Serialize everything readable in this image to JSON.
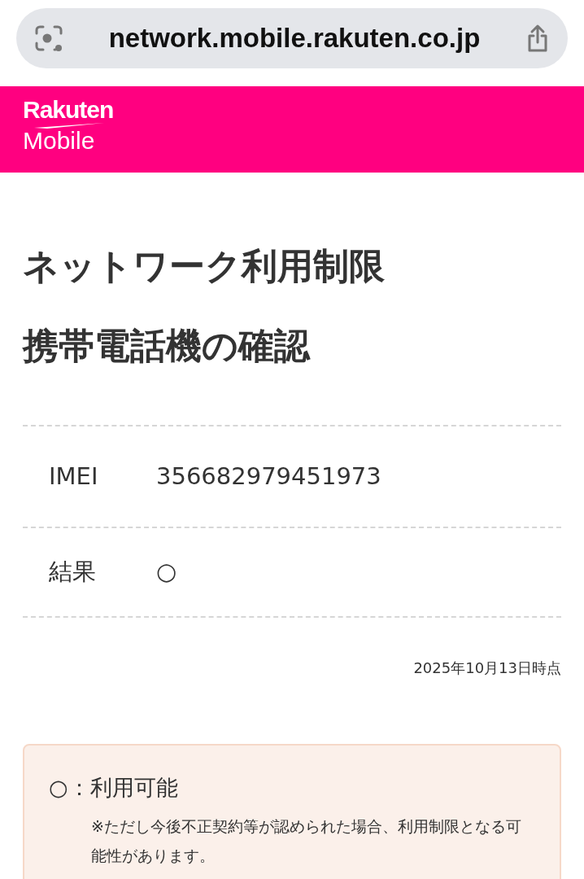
{
  "browser": {
    "url": "network.mobile.rakuten.co.jp"
  },
  "header": {
    "logo_top": "Rakuten",
    "logo_bottom": "Mobile"
  },
  "title_lines": [
    "ネットワーク利用制限",
    "携帯電話機の確認"
  ],
  "rows": [
    {
      "label": "IMEI",
      "value": "356682979451973"
    },
    {
      "label": "結果",
      "value": "○"
    }
  ],
  "as_of": "2025年10月13日時点",
  "legend": {
    "status": "○：利用可能",
    "note": "※ただし今後不正契約等が認められた場合、利用制限となる可能性があります。"
  }
}
